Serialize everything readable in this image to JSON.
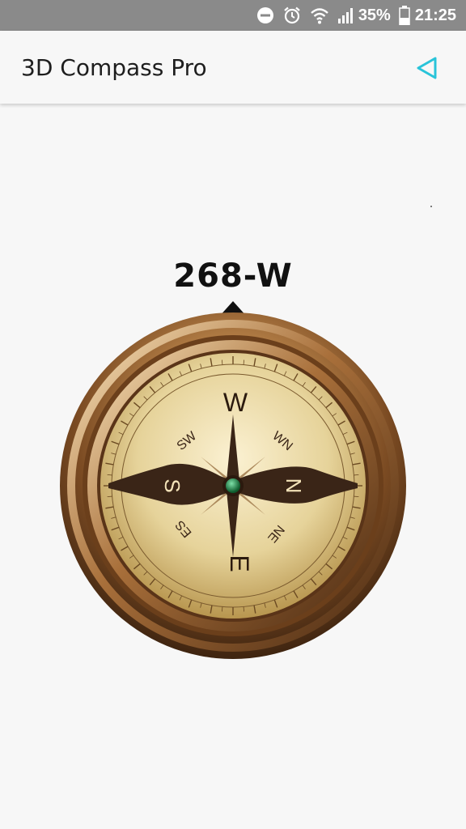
{
  "status_bar": {
    "battery": "35%",
    "time": "21:25"
  },
  "app_bar": {
    "title": "3D Compass Pro",
    "share_icon": "share-triangle-icon",
    "accent_color": "#29c4d9"
  },
  "compass": {
    "heading_label": "268-W",
    "cardinal_labels": {
      "top": "W",
      "bottom": "E",
      "left": "S",
      "right": "N"
    },
    "intercardinal_labels": {
      "top_left": "SW",
      "top_right": "WN",
      "bottom_left": "ES",
      "bottom_right": "NE"
    },
    "colors": {
      "bezel": "#8a5a2b",
      "face": "#e6d39a",
      "needle": "#3a2517",
      "center": "#1f8a4c"
    }
  }
}
